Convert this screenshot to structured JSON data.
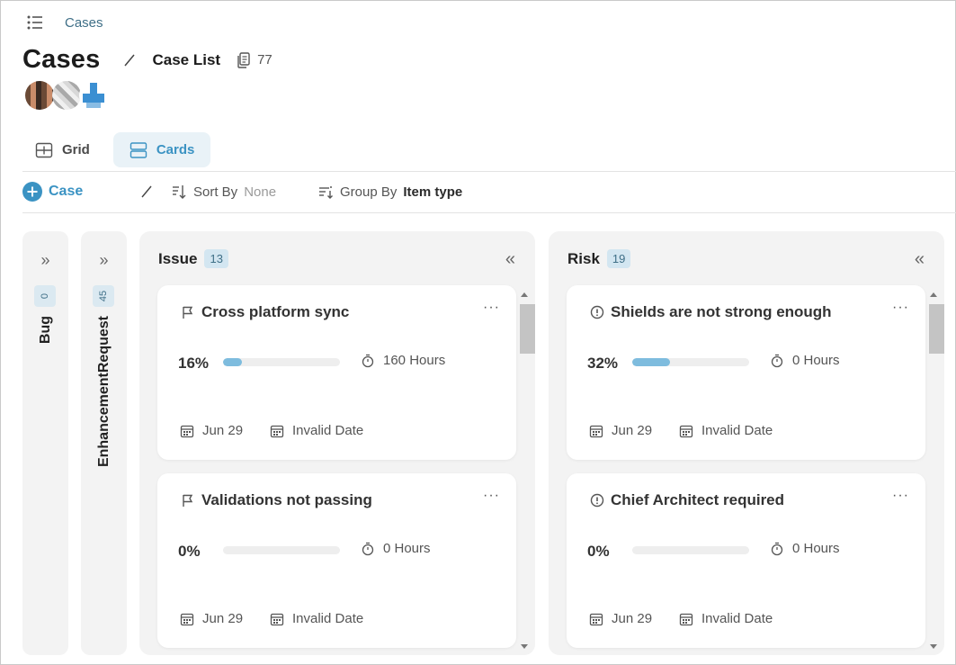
{
  "breadcrumb": {
    "menu_icon": "list-menu-icon",
    "label": "Cases"
  },
  "header": {
    "title": "Cases",
    "view_name": "Case List",
    "count": "77"
  },
  "tabs": [
    {
      "label": "Grid",
      "icon": "grid-icon",
      "active": false
    },
    {
      "label": "Cards",
      "icon": "cards-icon",
      "active": true
    }
  ],
  "toolbar": {
    "add_label": "Case",
    "sort_label": "Sort By",
    "sort_value": "None",
    "group_label": "Group By",
    "group_value": "Item type"
  },
  "collapsed_columns": [
    {
      "label": "Bug",
      "count": "0"
    },
    {
      "label": "EnhancementRequest",
      "count": "45"
    }
  ],
  "columns": [
    {
      "title": "Issue",
      "count": "13",
      "cards": [
        {
          "title": "Cross platform sync",
          "type_icon": "flag-icon",
          "percent_label": "16%",
          "progress": 0.16,
          "hours": "160 Hours",
          "start": "Jun 29",
          "end": "Invalid Date"
        },
        {
          "title": "Validations not passing",
          "type_icon": "flag-icon",
          "percent_label": "0%",
          "progress": 0,
          "hours": "0 Hours",
          "start": "Jun 29",
          "end": "Invalid Date"
        }
      ]
    },
    {
      "title": "Risk",
      "count": "19",
      "cards": [
        {
          "title": "Shields are not strong enough",
          "type_icon": "alert-icon",
          "percent_label": "32%",
          "progress": 0.32,
          "hours": "0 Hours",
          "start": "Jun 29",
          "end": "Invalid Date"
        },
        {
          "title": "Chief Architect required",
          "type_icon": "alert-icon",
          "percent_label": "0%",
          "progress": 0,
          "hours": "0 Hours",
          "start": "Jun 29",
          "end": "Invalid Date"
        }
      ]
    }
  ],
  "colors": {
    "accent": "#3b93c3",
    "progress_fill": "#7ebcde",
    "badge_bg": "#d3e6f1"
  }
}
